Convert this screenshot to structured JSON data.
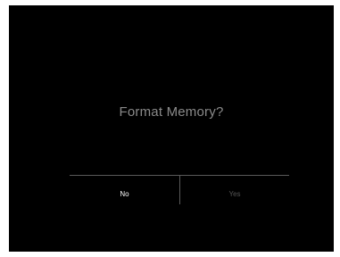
{
  "dialog": {
    "title": "Format Memory?",
    "options": [
      {
        "label": "No",
        "selected": true
      },
      {
        "label": "Yes",
        "selected": false
      }
    ]
  },
  "colors": {
    "background": "#000000",
    "title_text": "#8a8a8a",
    "selected_text": "#ffffff",
    "unselected_text": "#555555",
    "divider": "#5a5a5a"
  }
}
